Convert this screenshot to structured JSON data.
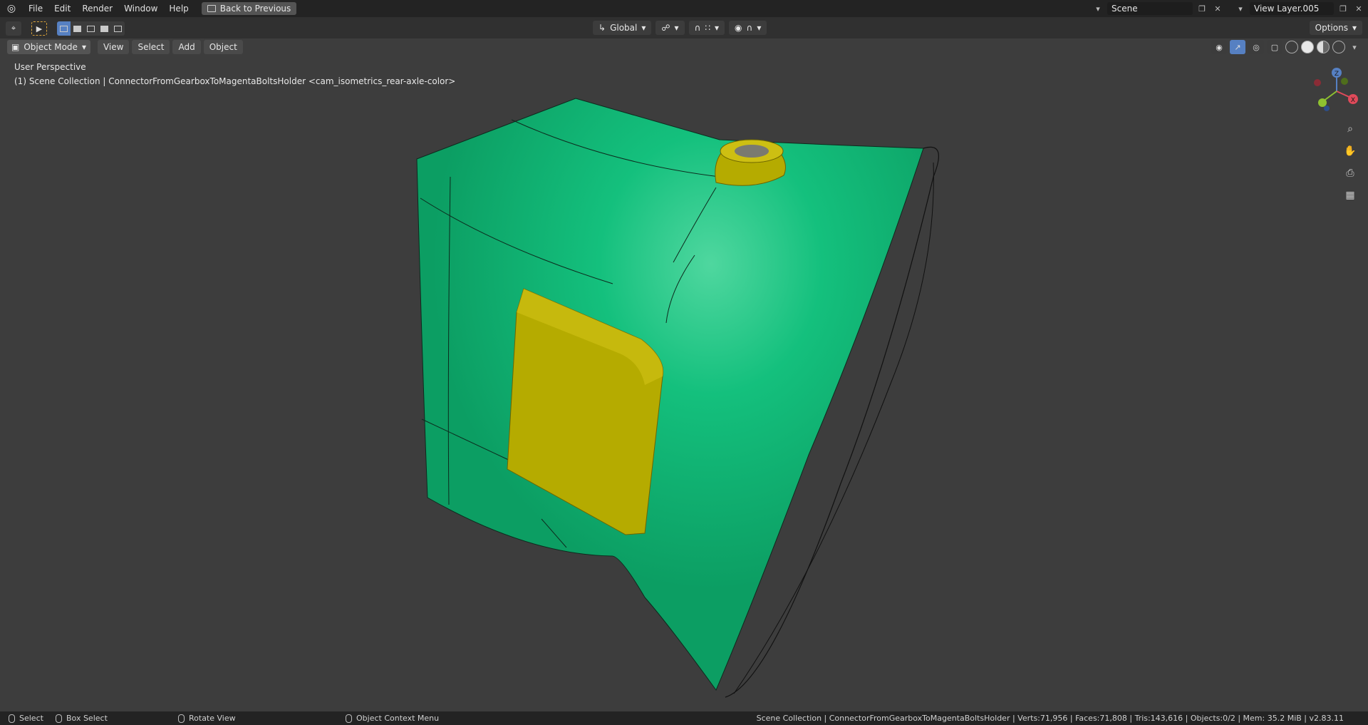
{
  "menu": {
    "items": [
      "File",
      "Edit",
      "Render",
      "Window",
      "Help"
    ],
    "back_button": "Back to Previous"
  },
  "topright": {
    "scene": "Scene",
    "view_layer": "View Layer.005"
  },
  "toolbar": {
    "transform_orientation": "Global",
    "options": "Options"
  },
  "viewport_header": {
    "mode": "Object Mode",
    "buttons": [
      "View",
      "Select",
      "Add",
      "Object"
    ]
  },
  "viewport": {
    "perspective": "User Perspective",
    "collection_line": "(1) Scene Collection | ConnectorFromGearboxToMagentaBoltsHolder <cam_isometrics_rear-axle-color>",
    "gizmo": {
      "x": "X",
      "y": "Y",
      "z": "Z"
    },
    "colors": {
      "body": "#12b877",
      "part": "#b5ab00",
      "background": "#3d3d3d"
    }
  },
  "status": {
    "select": "Select",
    "box_select": "Box Select",
    "rotate_view": "Rotate View",
    "context_menu": "Object Context Menu",
    "stats": "Scene Collection | ConnectorFromGearboxToMagentaBoltsHolder | Verts:71,956 | Faces:71,808 | Tris:143,616 | Objects:0/2 | Mem: 35.2 MiB | v2.83.11"
  }
}
